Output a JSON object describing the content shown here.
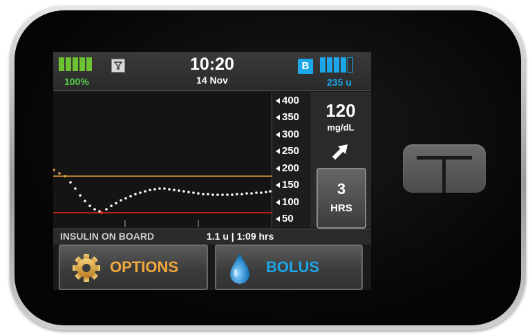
{
  "status": {
    "battery_percent": "100%",
    "time": "10:20",
    "date": "14 Nov",
    "bolus_badge": "B",
    "insulin_units": "235 u"
  },
  "axis": {
    "labels": [
      "400",
      "350",
      "300",
      "250",
      "200",
      "150",
      "100",
      "50"
    ]
  },
  "cgm": {
    "value": "120",
    "units": "mg/dL",
    "trend": "rising-diagonal-arrow-icon"
  },
  "timeframe": {
    "value": "3",
    "label": "HRS"
  },
  "iob": {
    "label": "INSULIN ON BOARD",
    "value": "1.1 u | 1:09 hrs"
  },
  "buttons": {
    "options": "OPTIONS",
    "bolus": "BOLUS"
  },
  "colors": {
    "high_line": "#e8a23a",
    "low_line": "#e0281e",
    "options_accent": "#f2a93b",
    "bolus_accent": "#1ba7ea",
    "battery": "#6cc230"
  },
  "icons": [
    "filter-icon",
    "gear-icon",
    "water-drop-icon",
    "tandem-t-button"
  ]
}
